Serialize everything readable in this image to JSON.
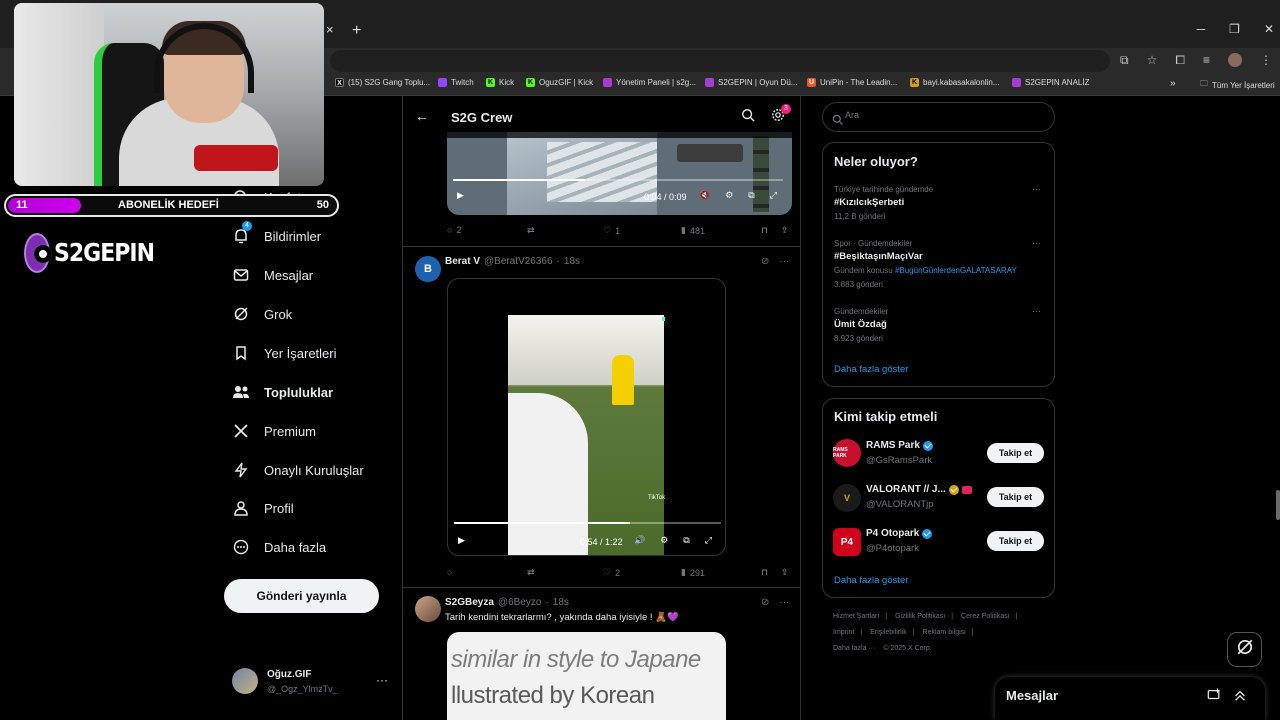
{
  "browser": {
    "tab_close": "×",
    "tab_new": "+",
    "window_controls": [
      "─",
      "❐",
      "✕"
    ],
    "bookmarks": [
      {
        "label": "(15) S2G Gang Toplu...",
        "color": "#000000",
        "glyph": "X"
      },
      {
        "label": "Twitch",
        "color": "#9146ff",
        "glyph": ""
      },
      {
        "label": "Kick",
        "color": "#53fc18",
        "glyph": "K"
      },
      {
        "label": "OguzGIF | Kick",
        "color": "#53fc18",
        "glyph": "K"
      },
      {
        "label": "Yönetim Paneli | s2g...",
        "color": "#a83bd4",
        "glyph": ""
      },
      {
        "label": "S2GEPIN | Oyun Dü...",
        "color": "#a83bd4",
        "glyph": ""
      },
      {
        "label": "UniPin - The Leadin...",
        "color": "#e8552b",
        "glyph": "U"
      },
      {
        "label": "bayi.kabasakalonlin...",
        "color": "#d89a1a",
        "glyph": "K"
      },
      {
        "label": "S2GEPIN ANALİZ",
        "color": "#a83bd4",
        "glyph": ""
      }
    ],
    "bookmarks_more": "»",
    "all_bookmarks": "Tüm Yer İşaretleri"
  },
  "overlay": {
    "sub_count_current": "11",
    "sub_title": "ABONELİK HEDEFİ",
    "sub_count_goal": "50",
    "sub_progress": 0.22,
    "logo_text": "S2GEPIN"
  },
  "nav": {
    "items": [
      {
        "label": "Keşfet",
        "icon": "search-icon"
      },
      {
        "label": "Bildirimler",
        "icon": "bell-icon",
        "badge": "4"
      },
      {
        "label": "Mesajlar",
        "icon": "mail-icon"
      },
      {
        "label": "Grok",
        "icon": "grok-icon"
      },
      {
        "label": "Yer İşaretleri",
        "icon": "bookmark-icon"
      },
      {
        "label": "Topluluklar",
        "icon": "communities-icon"
      },
      {
        "label": "Premium",
        "icon": "x-logo-icon"
      },
      {
        "label": "Onaylı Kuruluşlar",
        "icon": "lightning-icon"
      },
      {
        "label": "Profil",
        "icon": "person-icon"
      },
      {
        "label": "Daha fazla",
        "icon": "more-circle-icon"
      }
    ],
    "post_button": "Gönderi yayınla",
    "profile": {
      "name": "Oğuz.GIF",
      "handle": "@_Ogz_YlmzTv_",
      "more": "···"
    }
  },
  "center": {
    "title": "S2G Crew",
    "gear_badge": "3",
    "tweet1": {
      "video_time": "0:04 / 0:09",
      "video_progress": 0.4,
      "replies": "2",
      "retweets": "",
      "likes": "1",
      "views": "481"
    },
    "tweet2": {
      "avatar_letter": "B",
      "name": "Berat V",
      "handle": "@BeratV26366",
      "time": "18s",
      "video_time": "0:54 / 1:22",
      "video_progress": 0.66,
      "tiktok_label": "TikTok",
      "replies": "",
      "retweets": "",
      "likes": "2",
      "views": "291"
    },
    "tweet3": {
      "name": "S2GBeyza",
      "handle": "@6Beyzo",
      "time": "18s",
      "text": "Tarih kendini tekrarlarmı? , yakında daha iyisiyle ! 🧸💜",
      "image_line1": "similar in style to Japane",
      "image_line2": "llustrated by Korean"
    }
  },
  "right": {
    "search_placeholder": "Ara",
    "trends_title": "Neler oluyor?",
    "trends": [
      {
        "meta": "Türkiye tarihinde gündemde",
        "name": "#KızılcıkŞerbeti",
        "extra": "",
        "count": "11,2 B gönderi"
      },
      {
        "meta": "Spor · Gündemdekiler",
        "name": "#BeşiktaşınMaçıVar",
        "extra_prefix": "Gündem konusu",
        "extra": "#BugünGünlerdenGALATASARAY",
        "count": "3.883 gönderi"
      },
      {
        "meta": "Gündemdekiler",
        "name": "Ümit Özdağ",
        "extra": "",
        "count": "8.923 gönderi"
      }
    ],
    "trends_more": "Daha fazla göster",
    "wtf_title": "Kimi takip etmeli",
    "wtf": [
      {
        "name": "RAMS Park",
        "handle": "@GsRamsPark",
        "avatar_text": "RAMS PARK",
        "color": "#c8102e",
        "badge": "blue"
      },
      {
        "name": "VALORANT // J...",
        "handle": "@VALORANTjp",
        "avatar_text": "V",
        "color": "#1a1a1a",
        "badge": "gold"
      },
      {
        "name": "P4 Otopark",
        "handle": "@P4otopark",
        "avatar_text": "P4",
        "color": "#d0021b",
        "badge": "blue"
      }
    ],
    "follow_label": "Takip et",
    "wtf_more": "Daha fazla göster",
    "footer": [
      "Hizmet Şartları",
      "|",
      "Gizlilik Politikası",
      "|",
      "Çerez Politikası",
      "|",
      "Imprint",
      "|",
      "Erişilebilirlik",
      "|",
      "Reklam bilgisi",
      "|",
      "Daha fazla ···",
      "© 2025 X Corp."
    ],
    "messages_drawer": "Mesajlar"
  }
}
